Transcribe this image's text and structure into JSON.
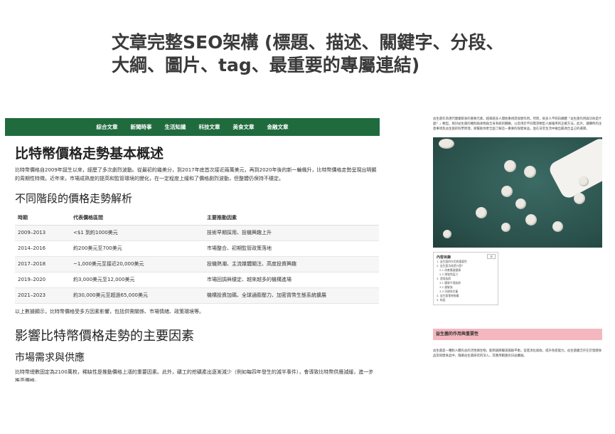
{
  "slide": {
    "title_line1": "文章完整SEO架構 (標題、描述、關鍵字、分段、",
    "title_line2": "大綱、圖片、tag、最重要的專屬連結)"
  },
  "article": {
    "nav": [
      "綜合文章",
      "新聞時事",
      "生活知識",
      "科技文章",
      "美食文章",
      "金融文章"
    ],
    "h1": "比特幣價格走勢基本概述",
    "intro": "比特幣價格自2009年誕生以來，經歷了多次劇烈波動。從最初的幾美分，到2017年底首次接近兩萬美元，再到2020年後的新一輪飆升，比特幣價格走勢呈現出明顯的周期性特徵。近年來，市場成熟度的提高和監管環境的變化，在一定程度上緩和了價格劇烈波動，但整體仍保持不穩定。",
    "h2_phases": "不同階段的價格走勢解析",
    "table": {
      "headers": [
        "時期",
        "代表價格區間",
        "主要推動因素"
      ],
      "rows": [
        [
          "2009–2013",
          "<$1 到約1000美元",
          "技術早期採用、投機興趣上升"
        ],
        [
          "2014–2016",
          "約200美元至700美元",
          "市場整合、初期監管政策落地"
        ],
        [
          "2017–2018",
          "~1,000美元至接近20,000美元",
          "投機熱潮、主流媒體關注、高度投資興趣"
        ],
        [
          "2019–2020",
          "約3,000美元至12,000美元",
          "市場回調與穩定、越來越多的機構進場"
        ],
        [
          "2021–2023",
          "約30,000美元至超過65,000美元",
          "機構投資加碼、全球通膨壓力、加密貨幣生態系統擴展"
        ]
      ]
    },
    "table_note": "以上數據顯示，比特幣價格受多方因素影響，包括供需關係、市場情緒、政策環境等。",
    "h2_factors": "影響比特幣價格走勢的主要因素",
    "h3_market": "市場需求與供應",
    "market_para": "比特幣總數固定為2100萬枚，稀缺性是推動價格上漲的重要因素。此外，礦工的挖礦產出逐漸減少（例如每四年發生的減半事件），會導致比特幣供應減緩，進一步推高價格。"
  },
  "side": {
    "intro": "益生菌作為現代健康飲食的重要元素，越來越多人開始重視其保健作用。然而，很多人不明白總體「益生菌作用與功效是什麼？」類型。探討益生菌的機制與食物與全身系統的關聯，以及用於不同需求類型人群服用的正確方法。此外，選購時的注意事項及益生菌的科學原理，將幫助你更全面了解這一重要的保健食品，並在日常生活中做出最適合自己的選擇。",
    "toc": {
      "title": "內容目錄",
      "toggle": "☰",
      "items": [
        "1. 益生菌的作用與重要性",
        "2. 益生菌功效是什麼？",
        "2.1 改善腸道健康",
        "2.2 增強免疫力",
        "3. 適用族群",
        "3.1 腸胃不適族群",
        "3.2 銀髮族",
        "3.3 孕婦與兒童",
        "4. 益生菌食物推薦",
        "5. 結語"
      ]
    },
    "section_heading": "益生菌的作用與重要性",
    "section_para": "益生菌是一種對人體有益的活性微生物，能夠調節腸道菌群平衡，促進消化吸收，提升免疫能力。益生菌廣泛存在於發酵食品及保健食品中，隨著益生菌研究的深入，其應用範圍也日益擴展。"
  },
  "colors": {
    "nav_bg": "#1f6b3e",
    "pink_heading_bg": "#f5b7bf"
  }
}
